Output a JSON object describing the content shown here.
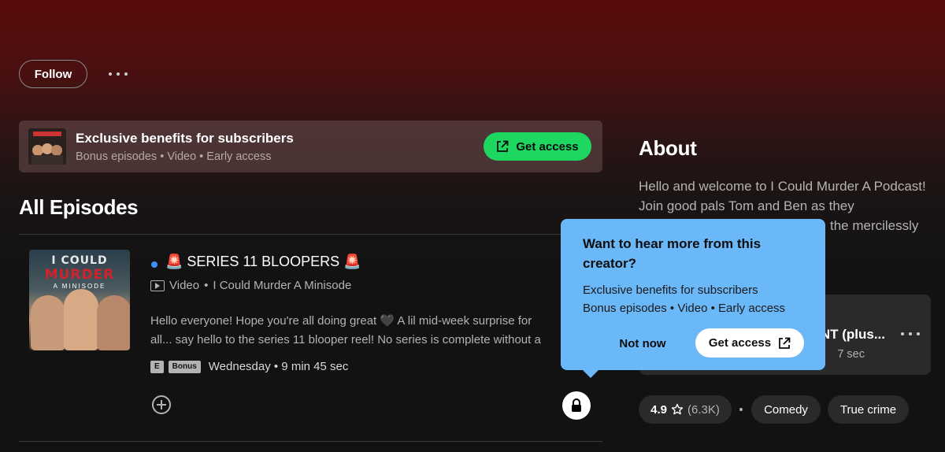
{
  "header": {
    "follow_label": "Follow"
  },
  "banner": {
    "title": "Exclusive benefits for subscribers",
    "subtitle": "Bonus episodes • Video • Early access",
    "button_label": "Get access"
  },
  "episodes": {
    "section_title": "All Episodes",
    "items": [
      {
        "art_line1": "I COULD",
        "art_line2": "MURDER",
        "art_line3": "A MINISODE",
        "title": "🚨 SERIES 11 BLOOPERS 🚨",
        "type": "Video",
        "show": "I Could Murder A Minisode",
        "desc_line1": "Hello everyone! Hope you're all doing great 🖤 A lil mid-week surprise for",
        "desc_line2": "all... say hello to the series 11 blooper reel! No series is complete without a",
        "explicit_tag": "E",
        "bonus_tag": "Bonus",
        "date_duration": "Wednesday • 9 min 45 sec"
      }
    ]
  },
  "about": {
    "title": "About",
    "text": "Hello and welcome to I Could Murder A Podcast! Join good pals Tom and Ben as they",
    "text_tail": "the mercilessly"
  },
  "side_card": {
    "title": "NT (plus...",
    "subtitle": "7 sec"
  },
  "pills": {
    "rating_value": "4.9",
    "rating_count": "(6.3K)",
    "genres": [
      "Comedy",
      "True crime"
    ]
  },
  "popover": {
    "title": "Want to hear more from this creator?",
    "line1": "Exclusive benefits for subscribers",
    "line2": "Bonus episodes • Video • Early access",
    "not_now_label": "Not now",
    "get_access_label": "Get access"
  },
  "colors": {
    "accent_green": "#1ed760",
    "popover_blue": "#6bb8f8",
    "new_dot": "#3d91f4"
  },
  "icons": [
    "more-icon",
    "external-link-icon",
    "video-icon",
    "add-icon",
    "lock-icon",
    "star-icon"
  ]
}
